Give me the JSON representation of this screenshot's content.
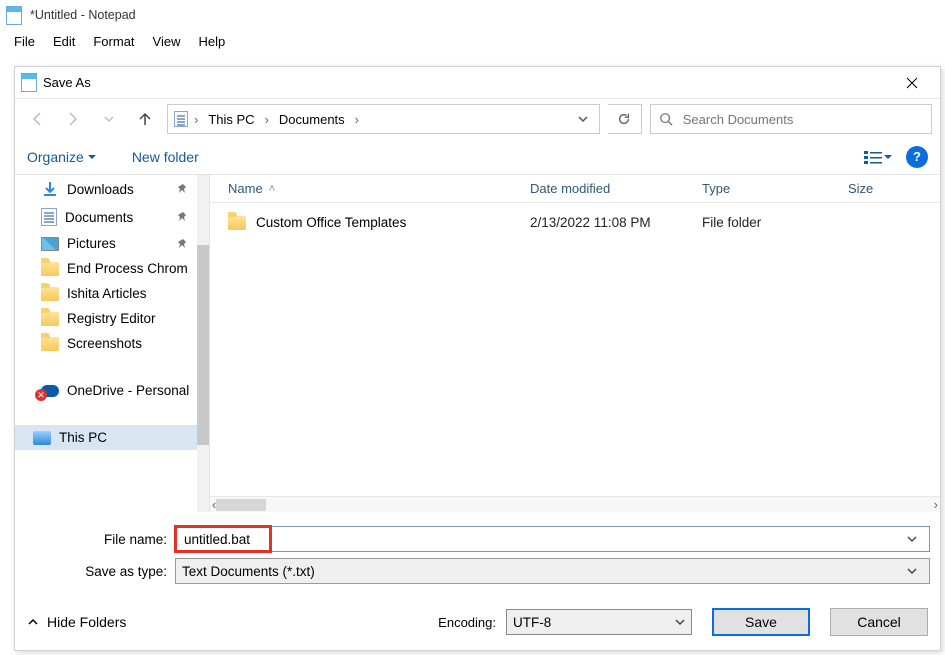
{
  "notepad": {
    "title": "*Untitled - Notepad",
    "menu": {
      "file": "File",
      "edit": "Edit",
      "format": "Format",
      "view": "View",
      "help": "Help"
    }
  },
  "dialog": {
    "title": "Save As",
    "breadcrumb": {
      "pc": "This PC",
      "docs": "Documents"
    },
    "search_placeholder": "Search Documents",
    "toolbar": {
      "organize": "Organize",
      "newfolder": "New folder"
    },
    "sidebar": {
      "items": [
        {
          "label": "Downloads",
          "kind": "downloads",
          "pinned": true
        },
        {
          "label": "Documents",
          "kind": "doc",
          "pinned": true
        },
        {
          "label": "Pictures",
          "kind": "pic",
          "pinned": true
        },
        {
          "label": "End Process Chrom",
          "kind": "folder"
        },
        {
          "label": "Ishita Articles",
          "kind": "folder"
        },
        {
          "label": "Registry Editor",
          "kind": "folder"
        },
        {
          "label": "Screenshots",
          "kind": "folder"
        },
        {
          "label": "OneDrive - Personal",
          "kind": "onedrive",
          "error": true
        },
        {
          "label": "This PC",
          "kind": "pc",
          "active": true
        }
      ]
    },
    "columns": {
      "name": "Name",
      "date": "Date modified",
      "type": "Type",
      "size": "Size"
    },
    "files": [
      {
        "name": "Custom Office Templates",
        "date": "2/13/2022 11:08 PM",
        "type": "File folder"
      }
    ],
    "form": {
      "filename_label": "File name:",
      "filename_value": "untitled.bat",
      "saveastype_label": "Save as type:",
      "saveastype_value": "Text Documents (*.txt)",
      "encoding_label": "Encoding:",
      "encoding_value": "UTF-8",
      "hide_folders": "Hide Folders",
      "save": "Save",
      "cancel": "Cancel"
    }
  }
}
